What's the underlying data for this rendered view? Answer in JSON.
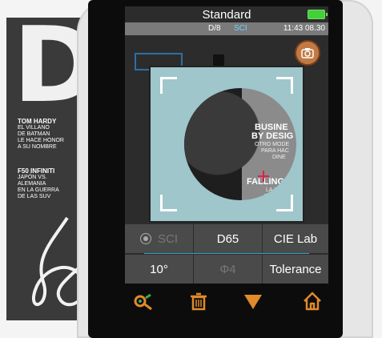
{
  "screen": {
    "title": "Standard",
    "battery_color": "#43d13a"
  },
  "infobar": {
    "geometry": "D/8",
    "mode": "SCI",
    "time": "11:43 08.30"
  },
  "preview": {
    "heading1": "BUSINE",
    "heading1b": "BY DESIG",
    "sub1": "OTRO MODE",
    "sub2": "PARA HAC",
    "sub3": "DINE",
    "heading2": "FALLING S",
    "sub4": "LA IN",
    "sub5": "DE"
  },
  "settings": {
    "row1": [
      "SCI",
      "D65",
      "CIE Lab"
    ],
    "row2": [
      "10°",
      "Φ4",
      "Tolerance"
    ]
  },
  "magazine": {
    "letter": "D",
    "headline1": "TOM HARDY",
    "line1": "EL VILLANO",
    "line2": "DE BATMAN",
    "line3": "LE HACE HONOR",
    "line4": "A SU NOMBRE",
    "headline2": "F50 INFINITI",
    "line5": "JAPÓN VS.",
    "line6": "ALEMANIA",
    "line7": "EN LA GUERRA",
    "line8": "DE LAS SUV"
  },
  "bottom_bar": {
    "icons": [
      "color-picker-icon",
      "trash-icon",
      "down-arrow-icon",
      "home-icon"
    ],
    "accent": "#e08a2a"
  }
}
